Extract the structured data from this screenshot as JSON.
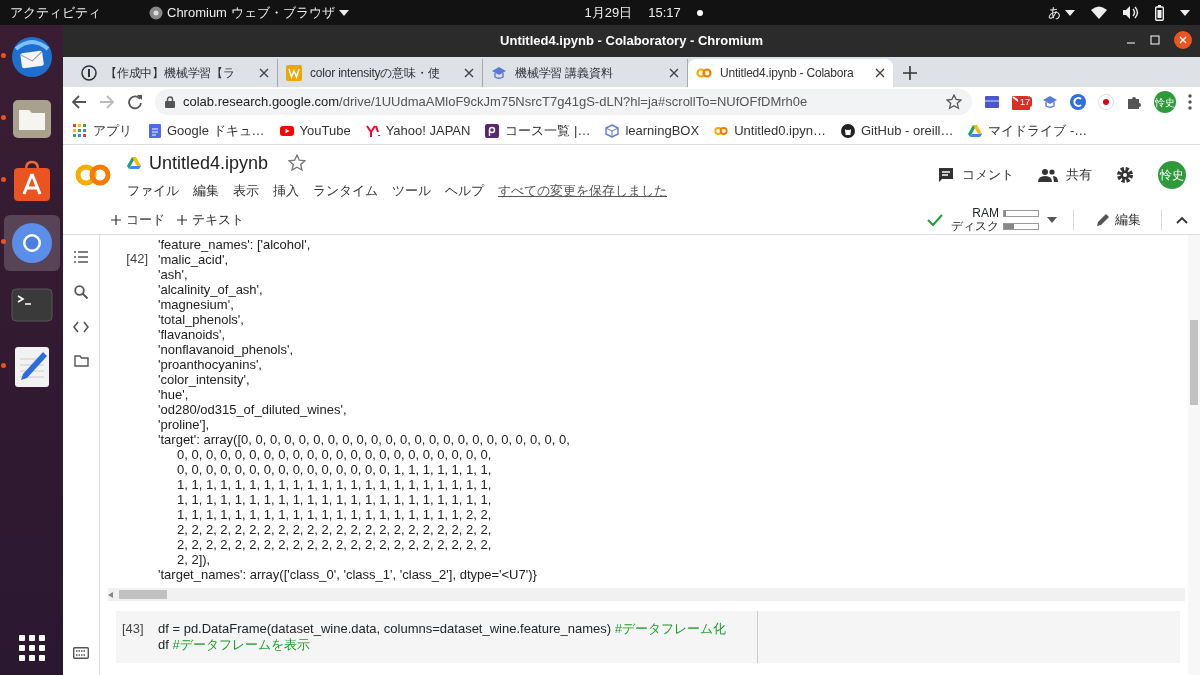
{
  "topbar": {
    "activities": "アクティビティ",
    "app": "Chromium ウェブ・ブラウザ",
    "date": "1月29日",
    "time": "15:17",
    "input_method": "あ"
  },
  "dock": [
    {
      "kind": "mail",
      "running": true,
      "selected": false
    },
    {
      "kind": "files",
      "running": true,
      "selected": false
    },
    {
      "kind": "store",
      "running": true,
      "selected": false
    },
    {
      "kind": "browser",
      "running": true,
      "selected": true
    },
    {
      "kind": "terminal",
      "running": false,
      "selected": false
    },
    {
      "kind": "editor",
      "running": true,
      "selected": false
    }
  ],
  "window": {
    "title": "Untitled4.ipynb - Colaboratory - Chromium"
  },
  "tabs": [
    {
      "kind": "info",
      "label": "【作成中】機械学習【ラ",
      "selected": false
    },
    {
      "kind": "w",
      "label": "color intensityの意味・使",
      "selected": false
    },
    {
      "kind": "cap",
      "label": "機械学習 講義資料",
      "selected": false
    },
    {
      "kind": "colab",
      "label": "Untitled4.ipynb - Colabora",
      "selected": true
    }
  ],
  "address": {
    "host": "colab.research.google.com",
    "path": "/drive/1UUdmaAMloF9ckJm75NsrcT7g41gS-dLN?hl=ja#scrollTo=NUfOFfDMrh0e",
    "mail_badge": "17",
    "avatar": "怜史"
  },
  "bookmarks": [
    {
      "kind": "apps",
      "label": "アプリ"
    },
    {
      "kind": "docs",
      "label": "Google ドキュ…"
    },
    {
      "kind": "youtube",
      "label": "YouTube"
    },
    {
      "kind": "yahoo",
      "label": "Yahoo! JAPAN"
    },
    {
      "kind": "course",
      "label": "コース一覧 |…"
    },
    {
      "kind": "box",
      "label": "learningBOX"
    },
    {
      "kind": "colab",
      "label": "Untitled0.ipyn…"
    },
    {
      "kind": "github",
      "label": "GitHub - oreill…"
    },
    {
      "kind": "drive",
      "label": "マイドライブ -…"
    }
  ],
  "notebook": {
    "name": "Untitled4.ipynb",
    "starred": false,
    "menu": [
      "ファイル",
      "編集",
      "表示",
      "挿入",
      "ランタイム",
      "ツール",
      "ヘルプ"
    ],
    "save_status": "すべての変更を保存しました",
    "comment": "コメント",
    "share": "共有",
    "avatar": "怜史"
  },
  "toolbar": {
    "add_code": "コード",
    "add_text": "テキスト",
    "connected": true,
    "ram_label": "RAM",
    "ram": {
      "level": 0.05
    },
    "disk_label": "ディスク",
    "disk": {
      "level": 0.3
    },
    "edit": "編集"
  },
  "output_cell": {
    "number": "[42]",
    "lines": [
      {
        "text": "'feature_names': ['alcohol',",
        "indent": false
      },
      {
        "text": "'malic_acid',",
        "indent": false
      },
      {
        "text": "'ash',",
        "indent": false
      },
      {
        "text": "'alcalinity_of_ash',",
        "indent": false
      },
      {
        "text": "'magnesium',",
        "indent": false
      },
      {
        "text": "'total_phenols',",
        "indent": false
      },
      {
        "text": "'flavanoids',",
        "indent": false
      },
      {
        "text": "'nonflavanoid_phenols',",
        "indent": false
      },
      {
        "text": "'proanthocyanins',",
        "indent": false
      },
      {
        "text": "'color_intensity',",
        "indent": false
      },
      {
        "text": "'hue',",
        "indent": false
      },
      {
        "text": "'od280/od315_of_diluted_wines',",
        "indent": false
      },
      {
        "text": "'proline'],",
        "indent": false
      },
      {
        "text": "'target': array([0, 0, 0, 0, 0, 0, 0, 0, 0, 0, 0, 0, 0, 0, 0, 0, 0, 0, 0, 0, 0, 0, 0,",
        "indent": false
      },
      {
        "text": "0, 0, 0, 0, 0, 0, 0, 0, 0, 0, 0, 0, 0, 0, 0, 0, 0, 0, 0, 0, 0, 0,",
        "indent": true
      },
      {
        "text": "0, 0, 0, 0, 0, 0, 0, 0, 0, 0, 0, 0, 0, 0, 0, 1, 1, 1, 1, 1, 1, 1,",
        "indent": true
      },
      {
        "text": "1, 1, 1, 1, 1, 1, 1, 1, 1, 1, 1, 1, 1, 1, 1, 1, 1, 1, 1, 1, 1, 1,",
        "indent": true
      },
      {
        "text": "1, 1, 1, 1, 1, 1, 1, 1, 1, 1, 1, 1, 1, 1, 1, 1, 1, 1, 1, 1, 1, 1,",
        "indent": true
      },
      {
        "text": "1, 1, 1, 1, 1, 1, 1, 1, 1, 1, 1, 1, 1, 1, 1, 1, 1, 1, 1, 1, 2, 2,",
        "indent": true
      },
      {
        "text": "2, 2, 2, 2, 2, 2, 2, 2, 2, 2, 2, 2, 2, 2, 2, 2, 2, 2, 2, 2, 2, 2,",
        "indent": true
      },
      {
        "text": "2, 2, 2, 2, 2, 2, 2, 2, 2, 2, 2, 2, 2, 2, 2, 2, 2, 2, 2, 2, 2, 2,",
        "indent": true
      },
      {
        "text": "2, 2]),",
        "indent": true
      },
      {
        "text": "'target_names': array(['class_0', 'class_1', 'class_2'], dtype='<U7')}",
        "indent": false
      }
    ]
  },
  "code_cell": {
    "number": "[43]",
    "lines": [
      [
        {
          "kind": "code",
          "text": "df = pd.DataFrame(dataset_wine.data, columns=dataset_wine.feature_names) "
        },
        {
          "kind": "comment",
          "text": "#データフレーム化"
        }
      ],
      [
        {
          "kind": "code",
          "text": "df "
        },
        {
          "kind": "comment",
          "text": "#データフレームを表示"
        }
      ]
    ]
  }
}
